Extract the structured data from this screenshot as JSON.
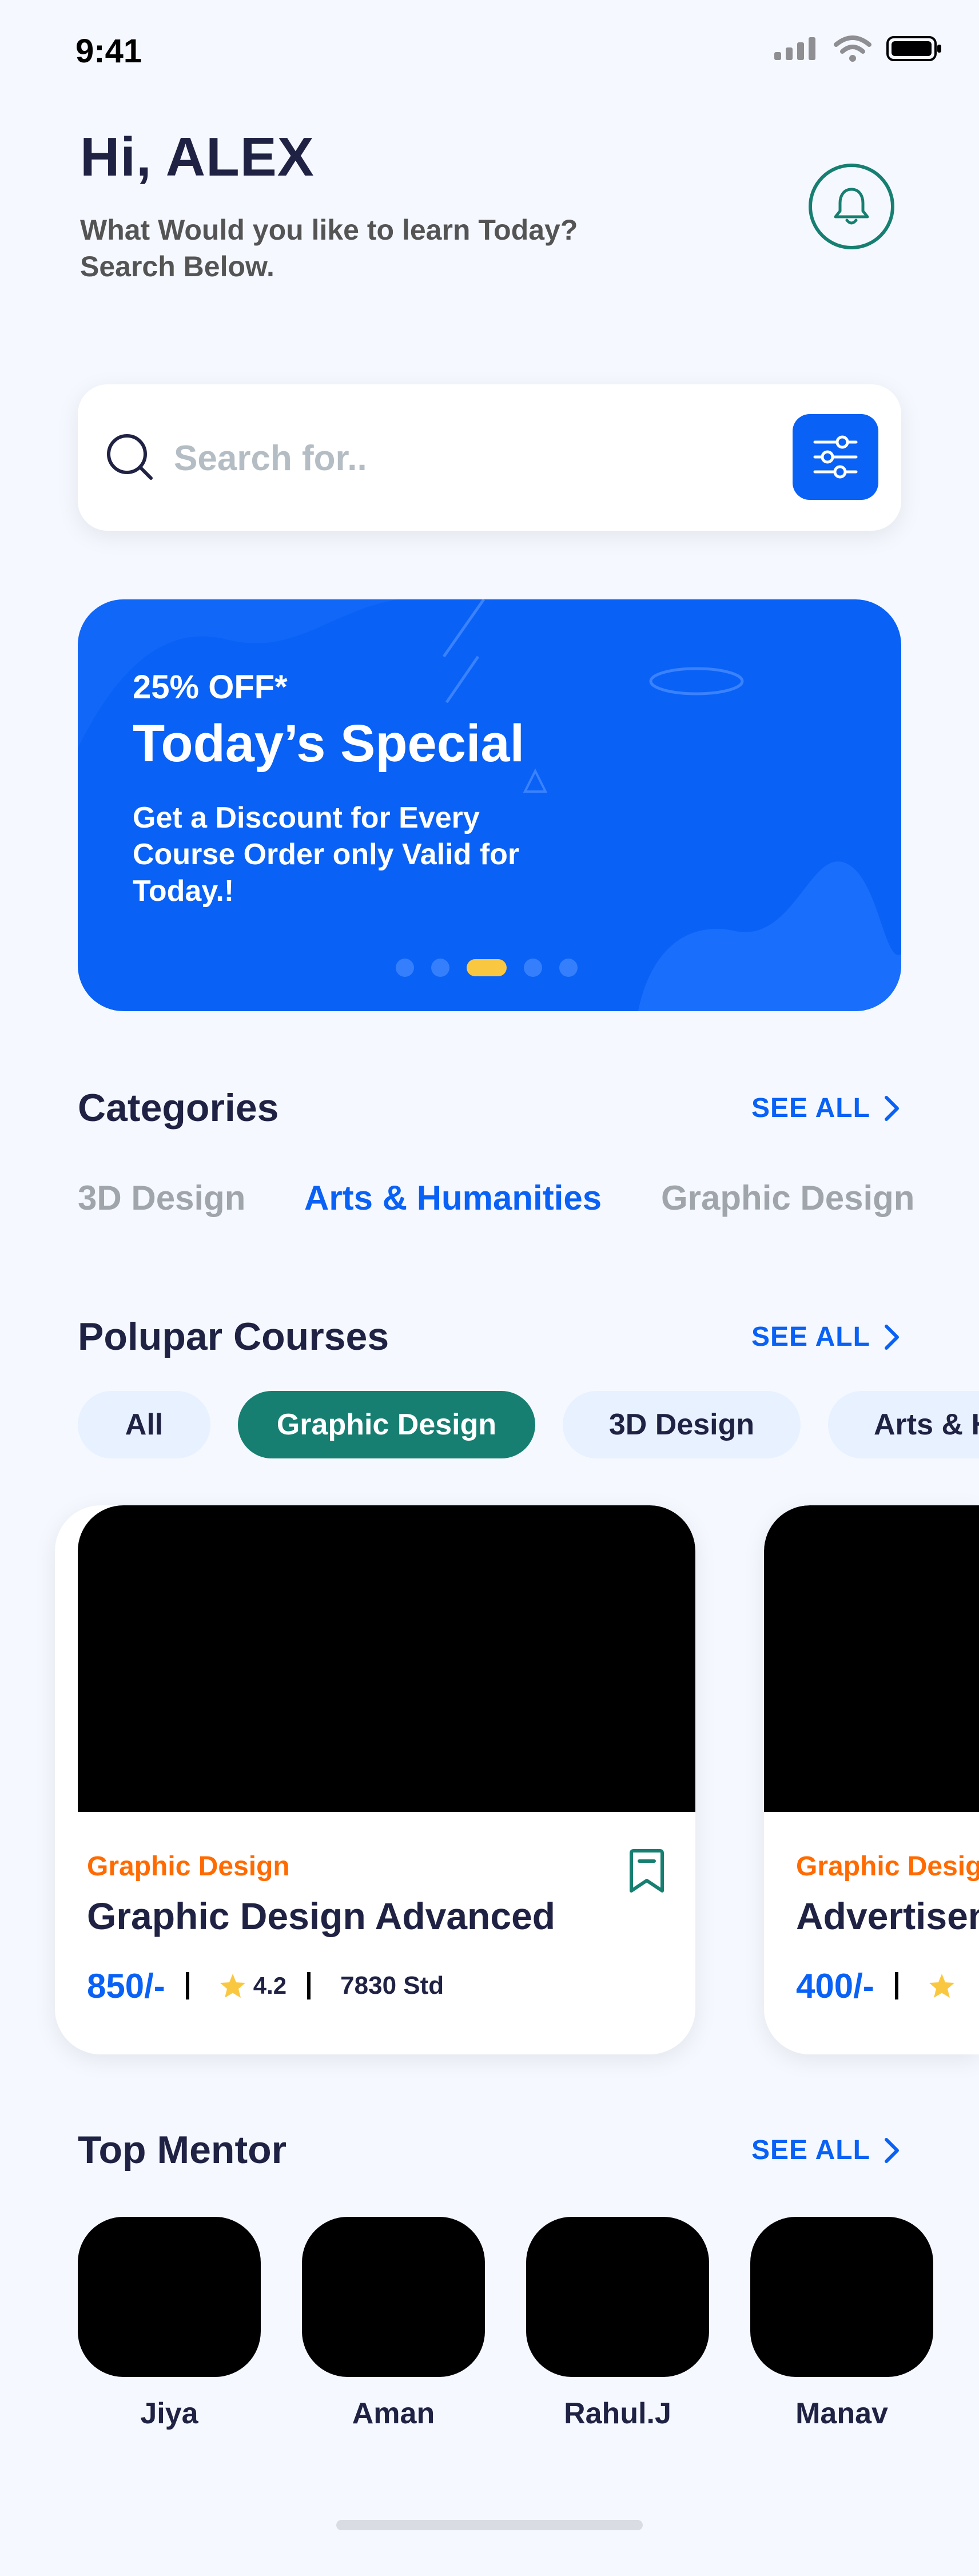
{
  "status_bar": {
    "time": "9:41"
  },
  "header": {
    "greeting": "Hi, ALEX",
    "subtitle_line1": "What Would you like to learn Today?",
    "subtitle_line2": "Search Below."
  },
  "search": {
    "placeholder": "Search for..",
    "value": ""
  },
  "promo": {
    "discount": "25% OFF*",
    "title": "Today’s Special",
    "description_line1": "Get a Discount for Every",
    "description_line2": "Course Order only Valid for",
    "description_line3": "Today.!",
    "active_slide": 3,
    "slide_count": 5
  },
  "categories": {
    "title": "Categories",
    "see_all": "SEE ALL",
    "items": [
      "3D Design",
      "Arts & Humanities",
      "Graphic Design"
    ],
    "active": "Arts & Humanities"
  },
  "popular": {
    "title": "Polupar Courses",
    "see_all": "SEE ALL",
    "chips": [
      "All",
      "Graphic Design",
      "3D Design",
      "Arts & H"
    ],
    "active_chip": "Graphic Design",
    "courses": [
      {
        "category": "Graphic Design",
        "title": "Graphic Design Advanced",
        "price": "850/-",
        "rating": "4.2",
        "students": "7830 Std"
      },
      {
        "category": "Graphic Desig",
        "title": "Advertisem",
        "price": "400/-",
        "rating": "",
        "students": ""
      }
    ]
  },
  "mentors": {
    "title": "Top Mentor",
    "see_all": "SEE ALL",
    "items": [
      "Jiya",
      "Aman",
      "Rahul.J",
      "Manav"
    ]
  },
  "colors": {
    "background": "#F5F9FF",
    "primary": "#0961F5",
    "accent_green": "#167F71",
    "accent_orange": "#FF6B00",
    "star": "#FAC840",
    "text_dark": "#202244"
  },
  "icons": [
    "signal-icon",
    "wifi-icon",
    "battery-icon",
    "bell-icon",
    "search-icon",
    "filter-icon",
    "chevron-right-icon",
    "star-icon",
    "bookmark-icon"
  ]
}
